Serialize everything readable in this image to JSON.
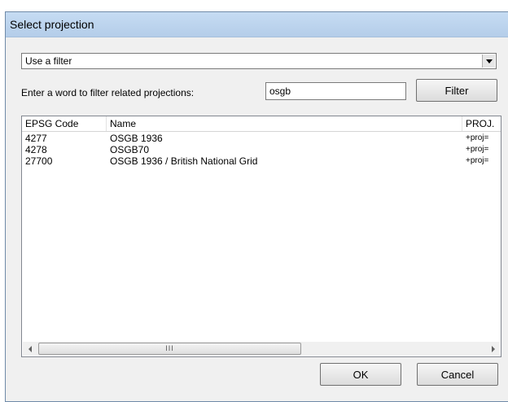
{
  "window": {
    "title": "Select projection"
  },
  "filter_mode": {
    "selected": "Use a filter"
  },
  "filter": {
    "label": "Enter a word to filter related projections:",
    "value": "osgb",
    "button_label": "Filter"
  },
  "table": {
    "columns": [
      "EPSG Code",
      "Name",
      "PROJ."
    ],
    "rows": [
      {
        "epsg": "4277",
        "name": "OSGB 1936",
        "proj": "+proj="
      },
      {
        "epsg": "4278",
        "name": "OSGB70",
        "proj": "+proj="
      },
      {
        "epsg": "27700",
        "name": "OSGB 1936 / British National Grid",
        "proj": "+proj="
      }
    ],
    "scroll_grip": "III"
  },
  "buttons": {
    "ok": "OK",
    "cancel": "Cancel"
  }
}
